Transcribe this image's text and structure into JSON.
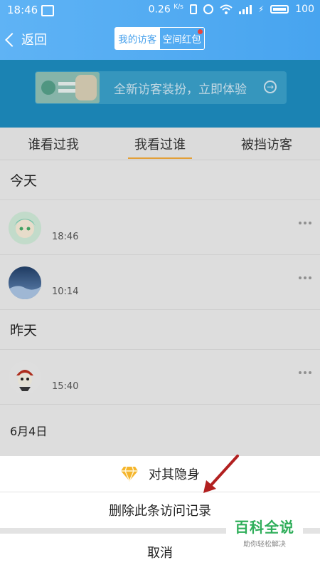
{
  "status_bar": {
    "time": "18:46",
    "speed": "0.26",
    "speed_unit": "K/s",
    "battery": "100"
  },
  "header": {
    "back_label": "返回",
    "segments": [
      {
        "label": "我的访客",
        "active": true
      },
      {
        "label": "空间红包",
        "active": false,
        "badge": true
      }
    ],
    "colors": {
      "header_blue": "#4aa6ef",
      "segment_active_text": "#46a0ec"
    }
  },
  "banner": {
    "text": "全新访客装扮，立即体验",
    "arrow": "→",
    "colors": {
      "background": "#1d8cbf"
    }
  },
  "tabs": [
    {
      "label": "谁看过我",
      "active": false
    },
    {
      "label": "我看过谁",
      "active": true
    },
    {
      "label": "被挡访客",
      "active": false
    }
  ],
  "list": {
    "sections": [
      {
        "title": "今天",
        "rows": [
          {
            "time": "18:46",
            "avatar": "anime-avatar"
          },
          {
            "time": "10:14",
            "avatar": "blue-sky-avatar"
          }
        ]
      },
      {
        "title": "昨天",
        "rows": [
          {
            "time": "15:40",
            "avatar": "cartoon-avatar"
          }
        ]
      },
      {
        "title": "6月4日",
        "rows": []
      }
    ]
  },
  "action_sheet": {
    "items": [
      {
        "label": "对其隐身",
        "icon": "diamond-icon"
      },
      {
        "label": "删除此条访问记录"
      },
      {
        "label": "取消"
      }
    ],
    "accent_color": "#f5b52b"
  },
  "watermark": {
    "title": "百科全说",
    "subtitle": "助你轻松解决"
  }
}
